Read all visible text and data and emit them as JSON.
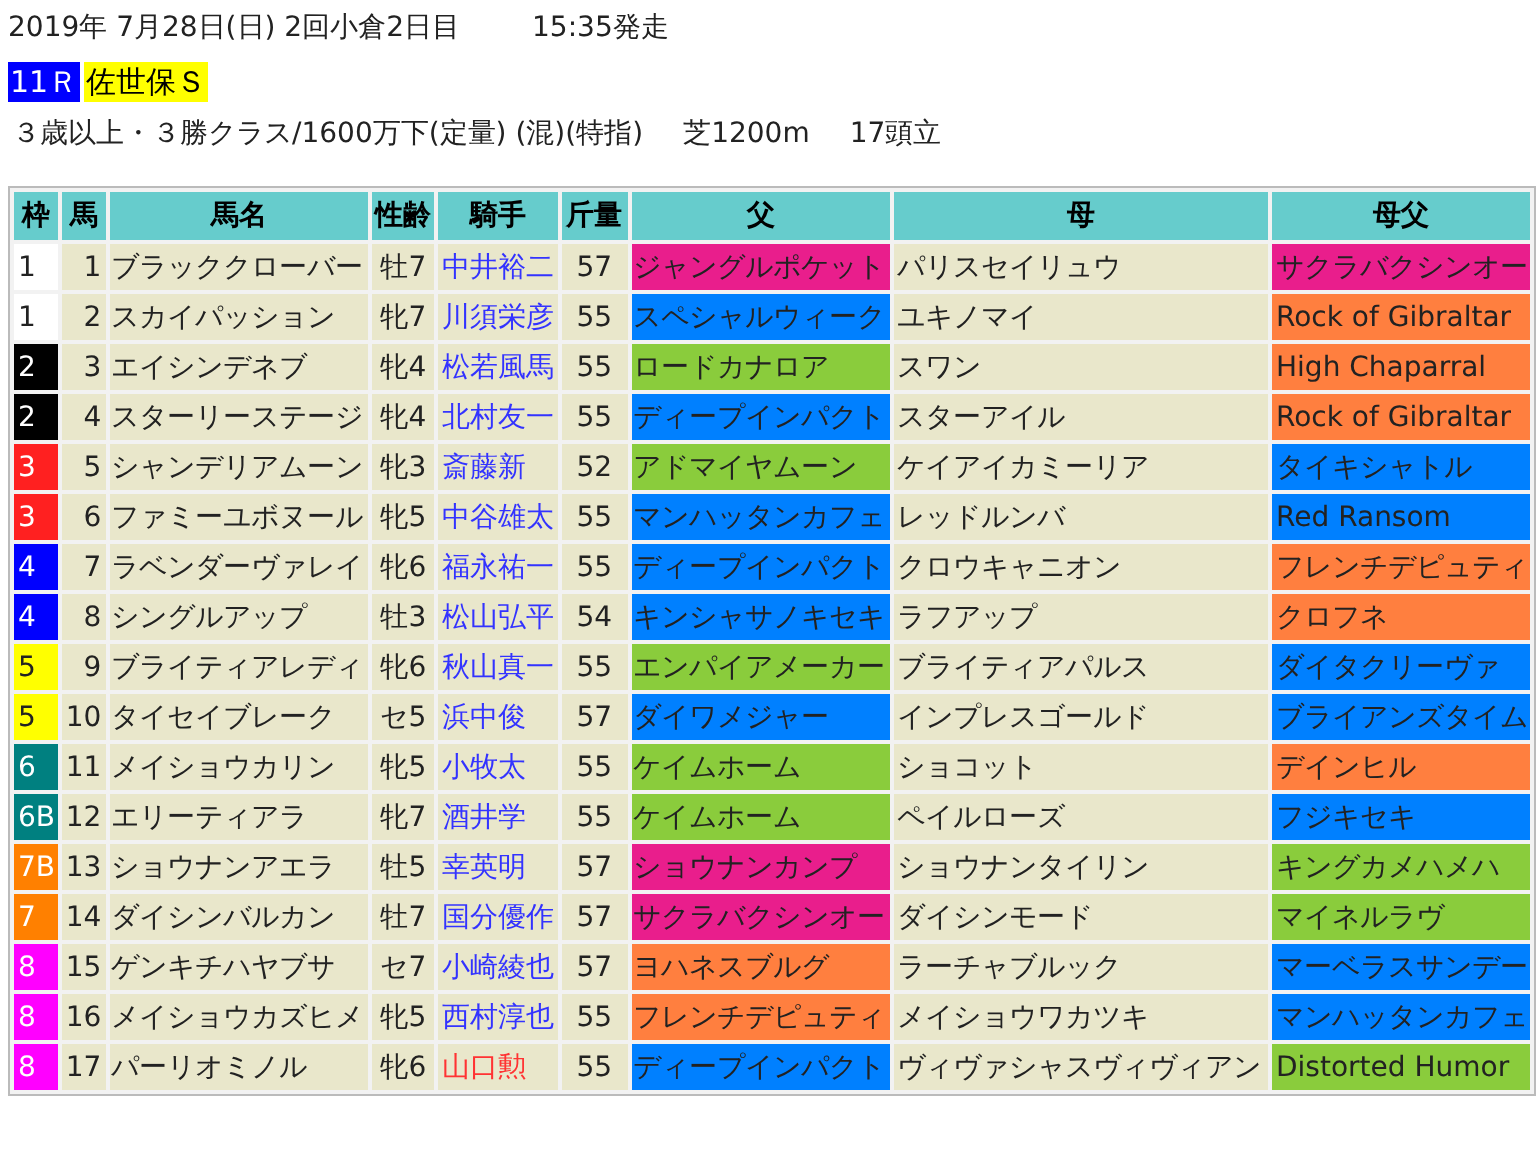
{
  "header": {
    "date": "2019年 7月28日(日) 2回小倉2日目",
    "start_time": "15:35発走",
    "race_number": "11Ｒ",
    "race_name": "佐世保Ｓ",
    "conditions": "３歳以上・３勝クラス/1600万下(定量) (混)(特指)",
    "course": "芝1200m",
    "runners": "17頭立"
  },
  "table": {
    "columns": [
      "枠",
      "馬",
      "馬名",
      "性齢",
      "騎手",
      "斤量",
      "父",
      "母",
      "母父"
    ],
    "rows": [
      {
        "waku": {
          "label": "1",
          "color": "#ffffff"
        },
        "number": "1",
        "name": "ブラッククローバー",
        "sex_age": "牡7",
        "jockey": {
          "name": "中井裕二",
          "color": "#3333ff"
        },
        "weight": "57",
        "sire": {
          "name": "ジャングルポケット",
          "color": "#e91e8c"
        },
        "dam": "パリスセイリュウ",
        "damsire": {
          "name": "サクラバクシンオー",
          "color": "#e91e8c"
        }
      },
      {
        "waku": {
          "label": "1",
          "color": "#ffffff"
        },
        "number": "2",
        "name": "スカイパッション",
        "sex_age": "牝7",
        "jockey": {
          "name": "川須栄彦",
          "color": "#3333ff"
        },
        "weight": "55",
        "sire": {
          "name": "スペシャルウィーク",
          "color": "#0080ff"
        },
        "dam": "ユキノマイ",
        "damsire": {
          "name": "Rock of Gibraltar",
          "color": "#ff7f3f"
        }
      },
      {
        "waku": {
          "label": "2",
          "color": "#000000"
        },
        "number": "3",
        "name": "エイシンデネブ",
        "sex_age": "牝4",
        "jockey": {
          "name": "松若風馬",
          "color": "#3333ff"
        },
        "weight": "55",
        "sire": {
          "name": "ロードカナロア",
          "color": "#8acc3c"
        },
        "dam": "スワン",
        "damsire": {
          "name": "High Chaparral",
          "color": "#ff7f3f"
        }
      },
      {
        "waku": {
          "label": "2",
          "color": "#000000"
        },
        "number": "4",
        "name": "スターリーステージ",
        "sex_age": "牝4",
        "jockey": {
          "name": "北村友一",
          "color": "#3333ff"
        },
        "weight": "55",
        "sire": {
          "name": "ディープインパクト",
          "color": "#0080ff"
        },
        "dam": "スターアイル",
        "damsire": {
          "name": "Rock of Gibraltar",
          "color": "#ff7f3f"
        }
      },
      {
        "waku": {
          "label": "3",
          "color": "#ff2020"
        },
        "number": "5",
        "name": "シャンデリアムーン",
        "sex_age": "牝3",
        "jockey": {
          "name": "斎藤新",
          "color": "#3333ff"
        },
        "weight": "52",
        "sire": {
          "name": "アドマイヤムーン",
          "color": "#8acc3c"
        },
        "dam": "ケイアイカミーリア",
        "damsire": {
          "name": "タイキシャトル",
          "color": "#0080ff"
        }
      },
      {
        "waku": {
          "label": "3",
          "color": "#ff2020"
        },
        "number": "6",
        "name": "ファミーユボヌール",
        "sex_age": "牝5",
        "jockey": {
          "name": "中谷雄太",
          "color": "#3333ff"
        },
        "weight": "55",
        "sire": {
          "name": "マンハッタンカフェ",
          "color": "#0080ff"
        },
        "dam": "レッドルンバ",
        "damsire": {
          "name": "Red Ransom",
          "color": "#0080ff"
        }
      },
      {
        "waku": {
          "label": "4",
          "color": "#0000ff"
        },
        "number": "7",
        "name": "ラベンダーヴァレイ",
        "sex_age": "牝6",
        "jockey": {
          "name": "福永祐一",
          "color": "#3333ff"
        },
        "weight": "55",
        "sire": {
          "name": "ディープインパクト",
          "color": "#0080ff"
        },
        "dam": "クロウキャニオン",
        "damsire": {
          "name": "フレンチデピュティ",
          "color": "#ff7f3f"
        }
      },
      {
        "waku": {
          "label": "4",
          "color": "#0000ff"
        },
        "number": "8",
        "name": "シングルアップ",
        "sex_age": "牡3",
        "jockey": {
          "name": "松山弘平",
          "color": "#3333ff"
        },
        "weight": "54",
        "sire": {
          "name": "キンシャサノキセキ",
          "color": "#0080ff"
        },
        "dam": "ラフアップ",
        "damsire": {
          "name": "クロフネ",
          "color": "#ff7f3f"
        }
      },
      {
        "waku": {
          "label": "5",
          "color": "#ffff00"
        },
        "number": "9",
        "name": "ブライティアレディ",
        "sex_age": "牝6",
        "jockey": {
          "name": "秋山真一",
          "color": "#3333ff"
        },
        "weight": "55",
        "sire": {
          "name": "エンパイアメーカー",
          "color": "#8acc3c"
        },
        "dam": "ブライティアパルス",
        "damsire": {
          "name": "ダイタクリーヴァ",
          "color": "#0080ff"
        }
      },
      {
        "waku": {
          "label": "5",
          "color": "#ffff00"
        },
        "number": "10",
        "name": "タイセイブレーク",
        "sex_age": "セ5",
        "jockey": {
          "name": "浜中俊",
          "color": "#3333ff"
        },
        "weight": "57",
        "sire": {
          "name": "ダイワメジャー",
          "color": "#0080ff"
        },
        "dam": "インプレスゴールド",
        "damsire": {
          "name": "ブライアンズタイム",
          "color": "#0080ff"
        }
      },
      {
        "waku": {
          "label": "6",
          "color": "#008080"
        },
        "number": "11",
        "name": "メイショウカリン",
        "sex_age": "牝5",
        "jockey": {
          "name": "小牧太",
          "color": "#3333ff"
        },
        "weight": "55",
        "sire": {
          "name": "ケイムホーム",
          "color": "#8acc3c"
        },
        "dam": "ショコット",
        "damsire": {
          "name": "デインヒル",
          "color": "#ff7f3f"
        }
      },
      {
        "waku": {
          "label": "6B",
          "color": "#008080"
        },
        "number": "12",
        "name": "エリーティアラ",
        "sex_age": "牝7",
        "jockey": {
          "name": "酒井学",
          "color": "#3333ff"
        },
        "weight": "55",
        "sire": {
          "name": "ケイムホーム",
          "color": "#8acc3c"
        },
        "dam": "ペイルローズ",
        "damsire": {
          "name": "フジキセキ",
          "color": "#0080ff"
        }
      },
      {
        "waku": {
          "label": "7B",
          "color": "#ff8000"
        },
        "number": "13",
        "name": "ショウナンアエラ",
        "sex_age": "牡5",
        "jockey": {
          "name": "幸英明",
          "color": "#3333ff"
        },
        "weight": "57",
        "sire": {
          "name": "ショウナンカンプ",
          "color": "#e91e8c"
        },
        "dam": "ショウナンタイリン",
        "damsire": {
          "name": "キングカメハメハ",
          "color": "#8acc3c"
        }
      },
      {
        "waku": {
          "label": "7",
          "color": "#ff8000"
        },
        "number": "14",
        "name": "ダイシンバルカン",
        "sex_age": "牡7",
        "jockey": {
          "name": "国分優作",
          "color": "#3333ff"
        },
        "weight": "57",
        "sire": {
          "name": "サクラバクシンオー",
          "color": "#e91e8c"
        },
        "dam": "ダイシンモード",
        "damsire": {
          "name": "マイネルラヴ",
          "color": "#8acc3c"
        }
      },
      {
        "waku": {
          "label": "8",
          "color": "#ff00ff"
        },
        "number": "15",
        "name": "ゲンキチハヤブサ",
        "sex_age": "セ7",
        "jockey": {
          "name": "小崎綾也",
          "color": "#3333ff"
        },
        "weight": "57",
        "sire": {
          "name": "ヨハネスブルグ",
          "color": "#ff7f3f"
        },
        "dam": "ラーチャブルック",
        "damsire": {
          "name": "マーベラスサンデー",
          "color": "#0080ff"
        }
      },
      {
        "waku": {
          "label": "8",
          "color": "#ff00ff"
        },
        "number": "16",
        "name": "メイショウカズヒメ",
        "sex_age": "牝5",
        "jockey": {
          "name": "西村淳也",
          "color": "#3333ff"
        },
        "weight": "55",
        "sire": {
          "name": "フレンチデピュティ",
          "color": "#ff7f3f"
        },
        "dam": "メイショウワカツキ",
        "damsire": {
          "name": "マンハッタンカフェ",
          "color": "#0080ff"
        }
      },
      {
        "waku": {
          "label": "8",
          "color": "#ff00ff"
        },
        "number": "17",
        "name": "パーリオミノル",
        "sex_age": "牝6",
        "jockey": {
          "name": "山口勲",
          "color": "#ff3333"
        },
        "weight": "55",
        "sire": {
          "name": "ディープインパクト",
          "color": "#0080ff"
        },
        "dam": "ヴィヴァシャスヴィヴィアン",
        "damsire": {
          "name": "Distorted Humor",
          "color": "#8acc3c"
        }
      }
    ]
  }
}
